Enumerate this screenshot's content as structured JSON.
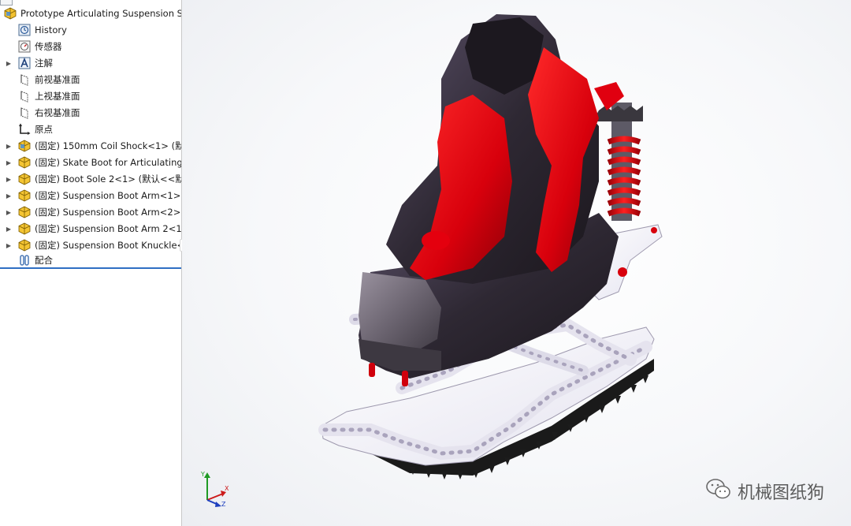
{
  "tree": {
    "root_label": "Prototype Articulating Suspension Sh",
    "items": [
      {
        "label": "History",
        "icon": "history-icon"
      },
      {
        "label": "传感器",
        "icon": "sensor-icon"
      },
      {
        "label": "注解",
        "icon": "annotation-icon"
      },
      {
        "label": "前视基准面",
        "icon": "plane-icon"
      },
      {
        "label": "上视基准面",
        "icon": "plane-icon"
      },
      {
        "label": "右视基准面",
        "icon": "plane-icon"
      },
      {
        "label": "原点",
        "icon": "origin-icon"
      },
      {
        "label": "(固定) 150mm Coil Shock<1> (默",
        "icon": "subassembly-icon"
      },
      {
        "label": "(固定) Skate Boot for Articulating",
        "icon": "part-icon"
      },
      {
        "label": "(固定) Boot Sole 2<1> (默认<<默",
        "icon": "part-icon"
      },
      {
        "label": "(固定) Suspension Boot Arm<1>",
        "icon": "part-icon"
      },
      {
        "label": "(固定) Suspension Boot Arm<2>",
        "icon": "part-icon"
      },
      {
        "label": "(固定) Suspension Boot Arm 2<1",
        "icon": "part-icon"
      },
      {
        "label": "(固定) Suspension Boot Knuckle<",
        "icon": "part-icon"
      },
      {
        "label": "配合",
        "icon": "mates-icon"
      }
    ]
  },
  "triad": {
    "x": "X",
    "y": "Y",
    "z": "Z"
  },
  "watermark": {
    "text": "机械图纸狗"
  },
  "colors": {
    "accent": "#2f6fc3",
    "boot_red": "#e0000d",
    "boot_dark": "#3a3440",
    "sole_white": "#f2f0f7"
  }
}
